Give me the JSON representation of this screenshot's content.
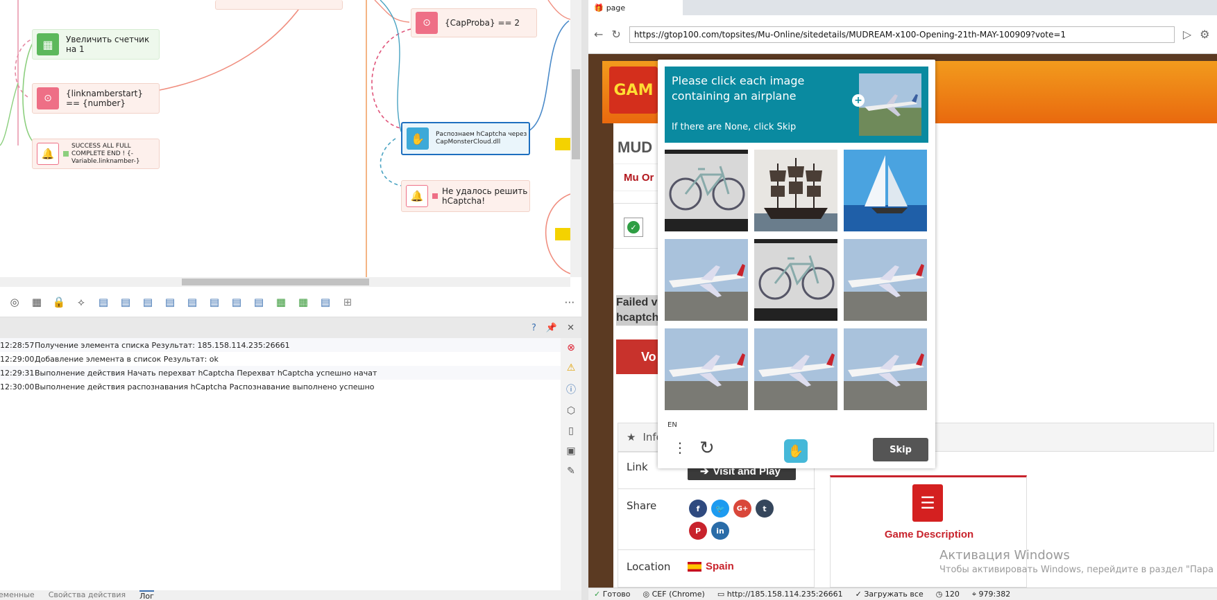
{
  "workflow": {
    "nodes": {
      "counter": "Увеличить счетчик на 1",
      "condition_link": "{linknamberstart} == {number}",
      "success": "SUCCESS ALL FULL COMPLETE END ! {-Variable.linknamber-}",
      "capproba": "{CapProba} == 2",
      "recognize": "Распознаем hCaptcha через CapMonsterCloud.dll",
      "fail": "Не удалось решить hCaptcha!"
    }
  },
  "log": {
    "rows": [
      {
        "time": "12:28:57",
        "text": "Получение элемента списка  Результат: 185.158.114.235:26661"
      },
      {
        "time": "12:29:00",
        "text": "Добавление элемента в список  Результат: ok"
      },
      {
        "time": "12:29:31",
        "text": "Выполнение действия Начать перехват hCaptcha Перехват hCaptcha успешно начат"
      },
      {
        "time": "12:30:00",
        "text": "Выполнение действия распознавания hCaptcha Распознавание выполнено успешно"
      }
    ],
    "tabs": [
      "Переменные",
      "Свойства действия",
      "Лог"
    ]
  },
  "browser": {
    "tab_title": "page",
    "url": "https://gtop100.com/topsites/Mu-Online/sitedetails/MUDREAM-x100-Opening-21th-MAY-100909?vote=1",
    "status": {
      "ready": "Готово",
      "engine": "CEF (Chrome)",
      "proxy": "http://185.158.114.235:26661",
      "load": "Загружать все",
      "timeout": "120",
      "coords": "979:382"
    }
  },
  "site": {
    "title_partial": "MUD",
    "server_partial": "Mu Or",
    "failed_text": "Failed v hcaptch",
    "vote_partial": "Vo",
    "info_partial": "Info",
    "link_label": "Link",
    "visit_button": "Visit and Play",
    "share_label": "Share",
    "location_label": "Location",
    "location_value": "Spain",
    "game_description": "Game Description",
    "activation_title": "Активация Windows",
    "activation_text": "Чтобы активировать Windows, перейдите в раздел \"Пара"
  },
  "captcha": {
    "prompt": "Please click each image containing an airplane",
    "hint": "If there are None, click Skip",
    "language": "EN",
    "skip_label": "Skip",
    "grid_icons": [
      "bicycle-image",
      "tall-ship-image",
      "sailboat-image",
      "airplane-image",
      "bicycle-image",
      "airplane-image",
      "airplane-image",
      "airplane-image",
      "airplane-image"
    ]
  },
  "colors": {
    "captcha_header": "#0a8aa0",
    "vote_red": "#c8322c",
    "node_green": "#5cb85c",
    "node_pink": "#ee6f86"
  }
}
